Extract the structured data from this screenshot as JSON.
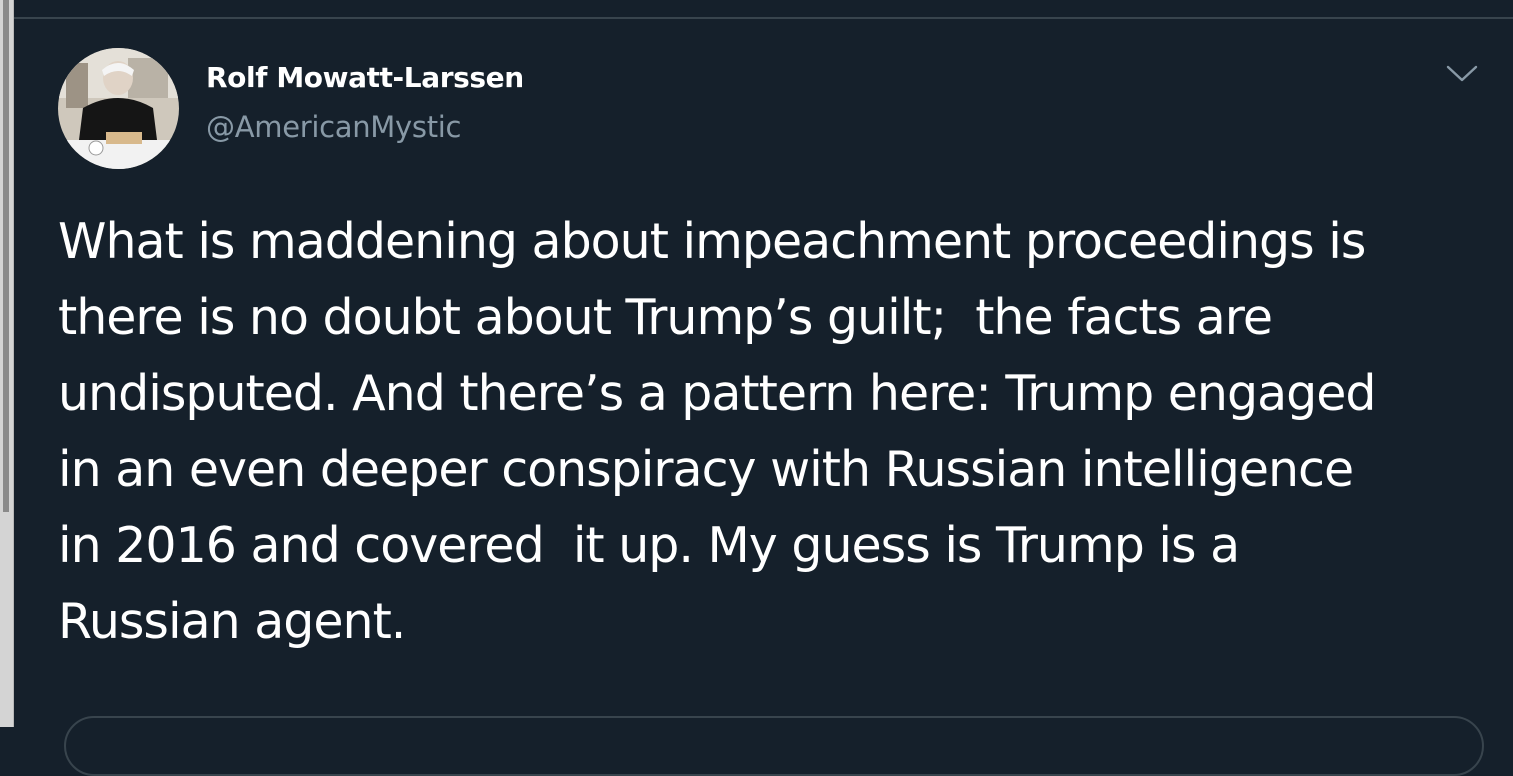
{
  "tweet": {
    "author_name": "Rolf Mowatt-Larssen",
    "author_handle": "@AmericanMystic",
    "text": "What is maddening about impeachment proceedings is\nthere is no doubt about Trump’s guilt;  the facts are\nundisputed. And there’s a pattern here: Trump engaged\nin an even deeper conspiracy with Russian intelligence\nin 2016 and covered  it up. My guess is Trump is a\nRussian agent.",
    "menu_icon": "chevron-down-icon"
  },
  "colors": {
    "background": "#15202b",
    "text_primary": "#ffffff",
    "text_secondary": "#8899a6",
    "border": "#38444d"
  }
}
